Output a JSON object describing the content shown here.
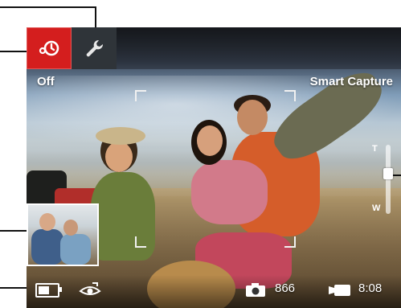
{
  "top_bar": {
    "flash_mode": {
      "icon": "flash-off-icon",
      "active": true,
      "color": "#d41e1e"
    },
    "tools": {
      "icon": "wrench-icon"
    }
  },
  "status": {
    "flash_label": "Off",
    "scene_label": "Smart Capture"
  },
  "zoom": {
    "tele_label": "T",
    "wide_label": "W",
    "level": 0.35
  },
  "bottom_bar": {
    "battery": {
      "icon": "battery-icon",
      "level": 0.6
    },
    "red_eye": {
      "icon": "red-eye-icon"
    },
    "pictures_remaining": {
      "icon": "camera-icon",
      "value": "866"
    },
    "record_time": {
      "icon": "video-camera-icon",
      "value": "8:08"
    }
  },
  "review": {
    "thumbnail": "last-picture-thumbnail"
  },
  "callouts": [
    "capture-mode-callout",
    "settings-callout",
    "zoom-callout",
    "thumbnail-callout",
    "battery-callout"
  ]
}
